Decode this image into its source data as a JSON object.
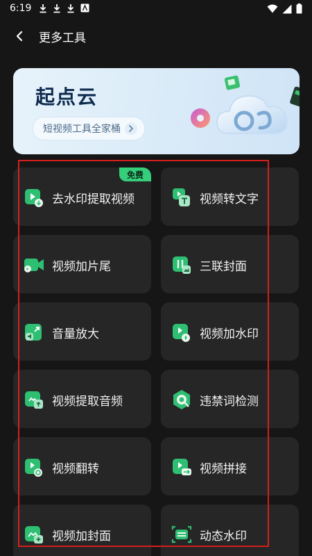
{
  "status_bar": {
    "time": "6:19"
  },
  "header": {
    "title": "更多工具",
    "back_icon": "chevron-left-icon"
  },
  "banner": {
    "title": "起点云",
    "subtitle": "短视频工具全家桶"
  },
  "tools": [
    {
      "label": "去水印提取视频",
      "badge": "免费",
      "icon": "remove-watermark-icon"
    },
    {
      "label": "视频转文字",
      "icon": "video-to-text-icon"
    },
    {
      "label": "视频加片尾",
      "icon": "video-add-ending-icon"
    },
    {
      "label": "三联封面",
      "icon": "triple-cover-icon"
    },
    {
      "label": "音量放大",
      "icon": "volume-amplify-icon"
    },
    {
      "label": "视频加水印",
      "icon": "video-add-watermark-icon"
    },
    {
      "label": "视频提取音频",
      "icon": "extract-audio-icon"
    },
    {
      "label": "违禁词检测",
      "icon": "banned-word-detect-icon"
    },
    {
      "label": "视频翻转",
      "icon": "video-flip-icon"
    },
    {
      "label": "视频拼接",
      "icon": "video-merge-icon"
    },
    {
      "label": "视频加封面",
      "icon": "video-add-cover-icon"
    },
    {
      "label": "动态水印",
      "icon": "dynamic-watermark-icon"
    }
  ],
  "colors": {
    "background": "#161616",
    "card": "#262626",
    "accent_green": "#35cf7c",
    "selection_red": "#d41f1f"
  }
}
